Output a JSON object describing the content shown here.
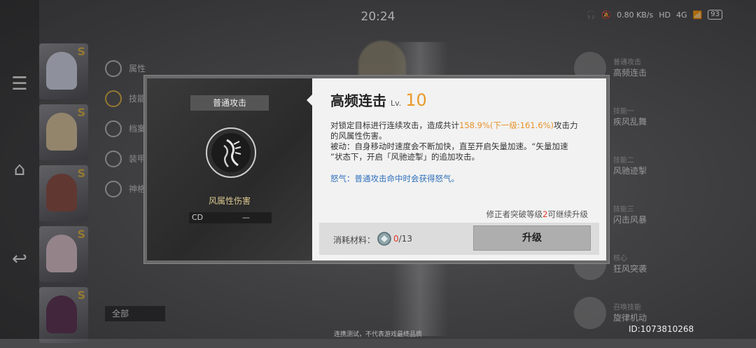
{
  "status_bar": {
    "time": "20:24",
    "network_speed": "0.80 KB/s",
    "hd": "HD",
    "signal": "4G",
    "battery": "93"
  },
  "nav": {
    "menu_icon": "menu-icon",
    "home_icon": "home-icon",
    "back_icon": "back-icon"
  },
  "characters": [
    {
      "rank": "S"
    },
    {
      "rank": "S"
    },
    {
      "rank": "S"
    },
    {
      "rank": "S"
    },
    {
      "rank": "S"
    }
  ],
  "background_menu": {
    "items": [
      "属性",
      "技能",
      "档案",
      "装甲",
      "神格"
    ],
    "all_label": "全部"
  },
  "skill_list": [
    {
      "type": "普通攻击",
      "name": "高频连击"
    },
    {
      "type": "技能一",
      "name": "疾风乱舞"
    },
    {
      "type": "技能二",
      "name": "风驰迹掣"
    },
    {
      "type": "技能三",
      "name": "闪击风暴"
    },
    {
      "type": "核心",
      "name": "狂风突袭"
    },
    {
      "type": "召唤技能",
      "name": "旋律机动"
    }
  ],
  "dialog": {
    "tag": "普通攻击",
    "damage_type": "风属性伤害",
    "cd_label": "CD",
    "cd_value": "—",
    "title": "高频连击",
    "level_prefix": "Lv.",
    "level": "10",
    "desc_line1_a": "对锁定目标进行连续攻击，造成共计",
    "desc_line1_hl": "158.9%(下一级:161.6%)",
    "desc_line1_b": "攻击力",
    "desc_line2": "的风属性伤害。",
    "desc_line3": "被动：自身移动时速度会不断加快，直至开启矢量加速。“矢量加速",
    "desc_line4": "”状态下，开启「风驰迹掣」的追加攻击。",
    "rage_text": "怒气：普通攻击命中时会获得怒气。",
    "req_prefix": "修正者突破等级",
    "req_num": "2",
    "req_suffix": "可继续升级",
    "mat_label": "消耗材料：",
    "mat_current": "0",
    "mat_total": "/13",
    "upgrade_label": "升级"
  },
  "footer": {
    "note": "连携测试，不代表游戏最终品质",
    "id": "ID:1073810268"
  },
  "colors": {
    "accent_orange": "#e89a2a",
    "rage_blue": "#2e6fbd",
    "warn_red": "#e0342a"
  }
}
